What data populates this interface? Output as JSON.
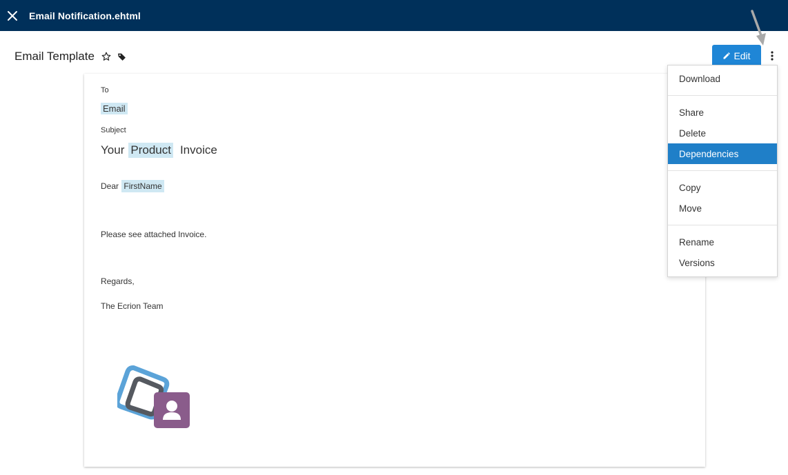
{
  "topbar": {
    "title": "Email Notification.ehtml",
    "close_icon": "close-icon",
    "bg_color": "#00305a"
  },
  "header": {
    "title": "Email Template",
    "star_icon": "star-outline-icon",
    "tag_icon": "tag-icon",
    "edit_label": "Edit",
    "edit_icon": "pencil-icon",
    "more_icon": "kebab-menu-icon",
    "accent_color": "#1f86d6"
  },
  "document": {
    "to_label": "To",
    "to_value": "Email",
    "subject_label": "Subject",
    "subject_prefix": "Your",
    "subject_field": "Product",
    "subject_suffix": "Invoice",
    "greeting": "Dear",
    "greeting_field": "FirstName",
    "body_line": "Please see attached Invoice.",
    "regards": "Regards,",
    "signature": "The Ecrion Team",
    "field_highlight_color": "#cfe8f3"
  },
  "menu": {
    "items": [
      {
        "label": "Download",
        "group": 1
      },
      {
        "label": "Share",
        "group": 2
      },
      {
        "label": "Delete",
        "group": 2
      },
      {
        "label": "Dependencies",
        "group": 2,
        "active": true
      },
      {
        "label": "Copy",
        "group": 3
      },
      {
        "label": "Move",
        "group": 3
      },
      {
        "label": "Rename",
        "group": 4
      },
      {
        "label": "Versions",
        "group": 4
      }
    ],
    "active_color": "#1f7fc8"
  }
}
